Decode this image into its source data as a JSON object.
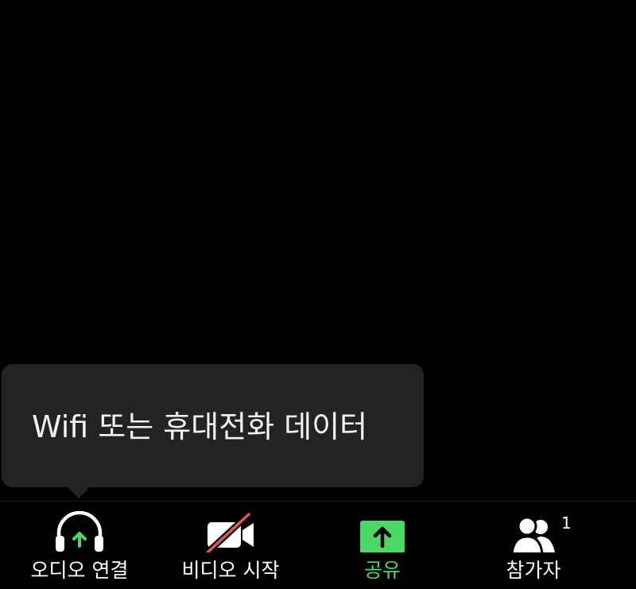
{
  "tooltip": {
    "text": "Wifi 또는 휴대전화 데이터"
  },
  "toolbar": {
    "audio_label": "오디오 연결",
    "video_label": "비디오 시작",
    "share_label": "공유",
    "participants_label": "참가자",
    "participants_count": "1"
  },
  "icons": {
    "audio": "headphones-upload-icon",
    "video": "video-camera-off-icon",
    "share": "share-screen-icon",
    "participants": "participants-icon"
  },
  "colors": {
    "background": "#000000",
    "tooltip_bg": "#232323",
    "accent_green": "#4bd865",
    "video_off_red": "#e05555",
    "text": "#ffffff"
  }
}
